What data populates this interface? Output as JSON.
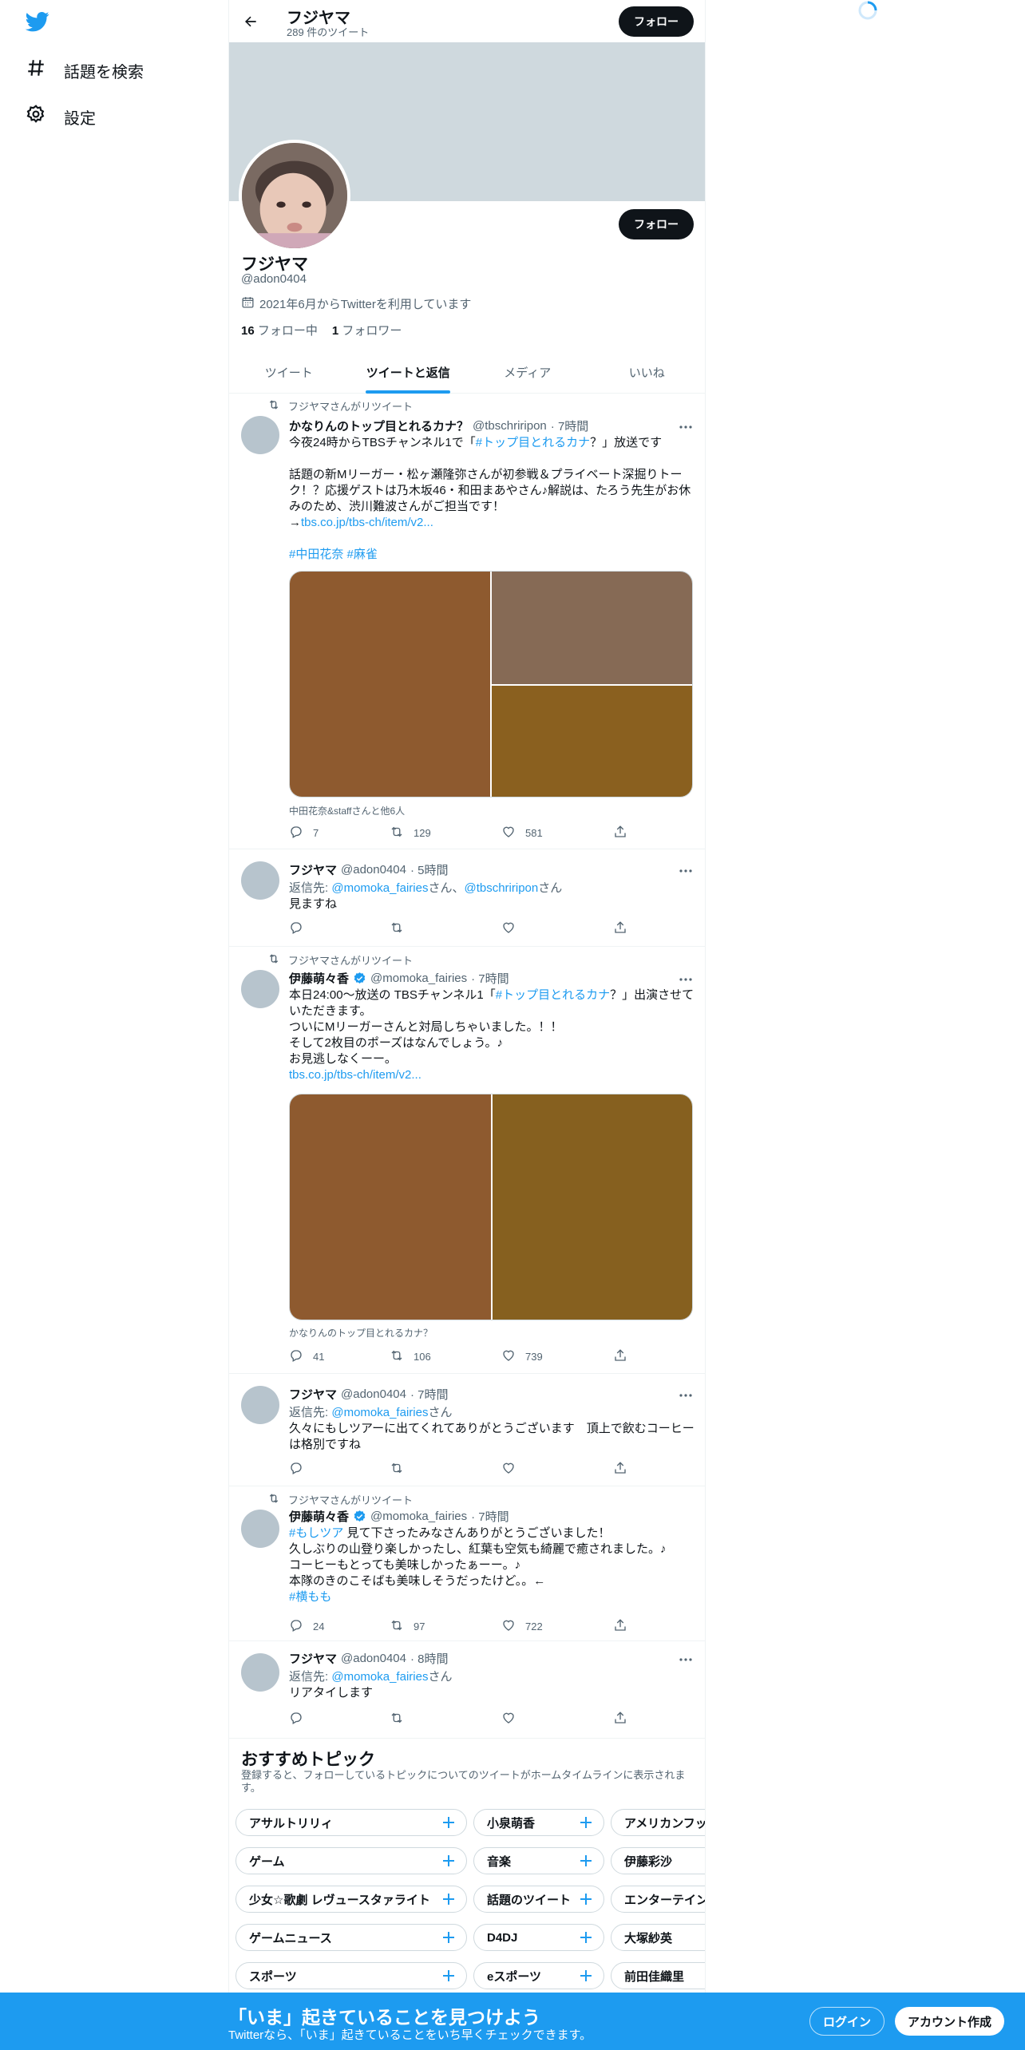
{
  "colors": {
    "accent": "#1d9bf0",
    "text": "#0f1419",
    "muted": "#536471",
    "banner": "#cfd9de"
  },
  "sidebar": {
    "logo": "twitter-bird-icon",
    "items": [
      {
        "label": "話題を検索",
        "icon": "hashtag-icon"
      },
      {
        "label": "設定",
        "icon": "gear-icon"
      }
    ]
  },
  "header": {
    "name": "フジヤマ",
    "tweet_count": "289 件のツイート",
    "follow_label": "フォロー"
  },
  "profile": {
    "name": "フジヤマ",
    "handle": "@adon0404",
    "joined": "2021年6月からTwitterを利用しています",
    "following_count": "16",
    "following_label": "フォロー中",
    "followers_count": "1",
    "followers_label": "フォロワー",
    "follow_label": "フォロー"
  },
  "tabs": [
    {
      "label": "ツイート"
    },
    {
      "label": "ツイートと返信",
      "active": true
    },
    {
      "label": "メディア"
    },
    {
      "label": "いいね"
    }
  ],
  "tweets": [
    {
      "retweeted_by": "フジヤマさんがリツイート",
      "name": "かなりんのトップ目とれるカナ？",
      "handle": "@tbschriripon",
      "time": "· 7時間",
      "text_a": "今夜24時からTBSチャンネル1で「",
      "text_link": "#トップ目とれるカナ",
      "text_b": "？」放送です\n\n話題の新Mリーガー・松ヶ瀬隆弥さんが初参戦＆プライベート深掘りトーク！？応援ゲストは乃木坂46・和田まあやさん♪解説は、たろう先生がお休みのため、渋川難波さんがご担当です！\n→",
      "url": "tbs.co.jp/tbs-ch/item/v2...",
      "hashtags": "#中田花奈 #麻雀",
      "media_tag": "中田花奈&staffさんと他6人",
      "replies": "7",
      "retweets": "129",
      "likes": "581"
    },
    {
      "name": "フジヤマ",
      "handle": "@adon0404",
      "time": "· 5時間",
      "reply_prefix": "返信先: ",
      "reply_to_1": "@momoka_fairies",
      "reply_mid": "さん、",
      "reply_to_2": "@tbschriripon",
      "reply_suffix": "さん",
      "text": "見ますね"
    },
    {
      "retweeted_by": "フジヤマさんがリツイート",
      "name": "伊藤萌々香",
      "handle": "@momoka_fairies",
      "time": "· 7時間",
      "text_a": "本日24:00〜放送の TBSチャンネル1「",
      "text_link": "#トップ目とれるカナ",
      "text_b": "？」出演させていただきます。\nついにMリーガーさんと対局しちゃいました。！！\nそして2枚目のポーズはなんでしょう。♪\nお見逃しなくーー。",
      "url": "tbs.co.jp/tbs-ch/item/v2...",
      "media_tag": "かなりんのトップ目とれるカナ？",
      "replies": "41",
      "retweets": "106",
      "likes": "739"
    },
    {
      "name": "フジヤマ",
      "handle": "@adon0404",
      "time": "· 7時間",
      "reply_prefix": "返信先: ",
      "reply_to_1": "@momoka_fairies",
      "reply_suffix": "さん",
      "text": "久々にもしツアーに出てくれてありがとうございます　頂上で飲むコーヒーは格別ですね"
    },
    {
      "retweeted_by": "フジヤマさんがリツイート",
      "name": "伊藤萌々香",
      "handle": "@momoka_fairies",
      "time": "· 7時間",
      "text_link": "#もしツア",
      "text_b": " 見て下さったみなさんありがとうございました！\n久しぶりの山登り楽しかったし、紅葉も空気も綺麗で癒されました。♪\nコーヒーもとっても美味しかったぁーー。♪\n本隊のきのこそばも美味しそうだったけど。。←",
      "hashtag_end": "#横もも",
      "replies": "24",
      "retweets": "97",
      "likes": "722"
    },
    {
      "name": "フジヤマ",
      "handle": "@adon0404",
      "time": "· 8時間",
      "reply_prefix": "返信先: ",
      "reply_to_1": "@momoka_fairies",
      "reply_suffix": "さん",
      "text": "リアタイします"
    }
  ],
  "topics": {
    "title": "おすすめトピック",
    "subtitle": "登録すると、フォローしているトピックについてのツイートがホームタイムラインに表示されます。",
    "col1": [
      "アサルトリリィ",
      "ゲーム",
      "少女☆歌劇 レヴュースタァライト",
      "ゲームニュース",
      "スポーツ"
    ],
    "col2": [
      "小泉萌香",
      "音楽",
      "話題のツイート",
      "D4DJ",
      "eスポーツ"
    ],
    "col3": [
      "アメリカンフットボール",
      "伊藤彩沙",
      "エンターテインメント",
      "大塚紗英",
      "前田佳織里"
    ]
  },
  "bottom_bar": {
    "title": "「いま」起きていることを見つけよう",
    "subtitle": "Twitterなら、「いま」起きていることをいち早くチェックできます。",
    "login": "ログイン",
    "signup": "アカウント作成"
  }
}
